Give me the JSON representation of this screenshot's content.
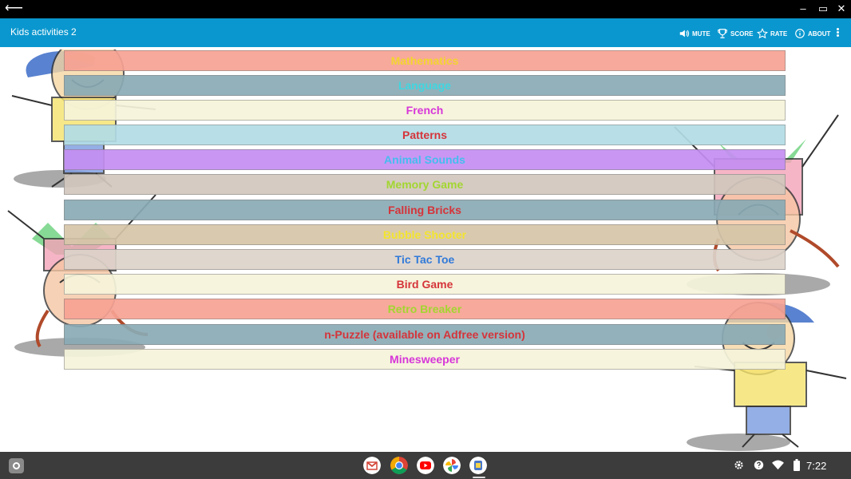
{
  "window": {
    "back_glyph": "⟵",
    "minimize_glyph": "–",
    "maximize_glyph": "▭",
    "close_glyph": "✕"
  },
  "appbar": {
    "title": "Kids activities 2",
    "actions": [
      {
        "label": "MUTE",
        "icon": "speaker-icon"
      },
      {
        "label": "SCORE",
        "icon": "trophy-icon"
      },
      {
        "label": "RATE",
        "icon": "star-icon"
      },
      {
        "label": "ABOUT",
        "icon": "info-icon"
      }
    ]
  },
  "menu": {
    "items": [
      {
        "label": "Mathematics",
        "bg": "#f7a293",
        "color": "#f2d21e"
      },
      {
        "label": "Language",
        "bg": "#8aabb5",
        "color": "#2fd3de"
      },
      {
        "label": "French",
        "bg": "#f6f4da",
        "color": "#d425d6"
      },
      {
        "label": "Patterns",
        "bg": "#b3dde6",
        "color": "#d2232a"
      },
      {
        "label": "Animal Sounds",
        "bg": "#c58ff2",
        "color": "#35b8ee"
      },
      {
        "label": "Memory Game",
        "bg": "#d2c7bd",
        "color": "#9bd31f"
      },
      {
        "label": "Falling Bricks",
        "bg": "#8aabb5",
        "color": "#d2232a"
      },
      {
        "label": "Bubble Shooter",
        "bg": "#d6c6a9",
        "color": "#f2e21e"
      },
      {
        "label": "Tic Tac Toe",
        "bg": "#ddd3ca",
        "color": "#1f6fd6"
      },
      {
        "label": "Bird Game",
        "bg": "#f6f4da",
        "color": "#d2232a"
      },
      {
        "label": "Retro Breaker",
        "bg": "#f7a293",
        "color": "#9bd31f"
      },
      {
        "label": "n-Puzzle (available on Adfree version)",
        "bg": "#8aabb5",
        "color": "#d2232a"
      },
      {
        "label": "Minesweeper",
        "bg": "#f6f4da",
        "color": "#d425d6"
      }
    ]
  },
  "taskbar": {
    "apps": [
      {
        "name": "gmail-icon"
      },
      {
        "name": "chrome-icon"
      },
      {
        "name": "youtube-icon"
      },
      {
        "name": "photos-icon"
      },
      {
        "name": "kids-activities-icon"
      }
    ],
    "time": "7:22"
  }
}
